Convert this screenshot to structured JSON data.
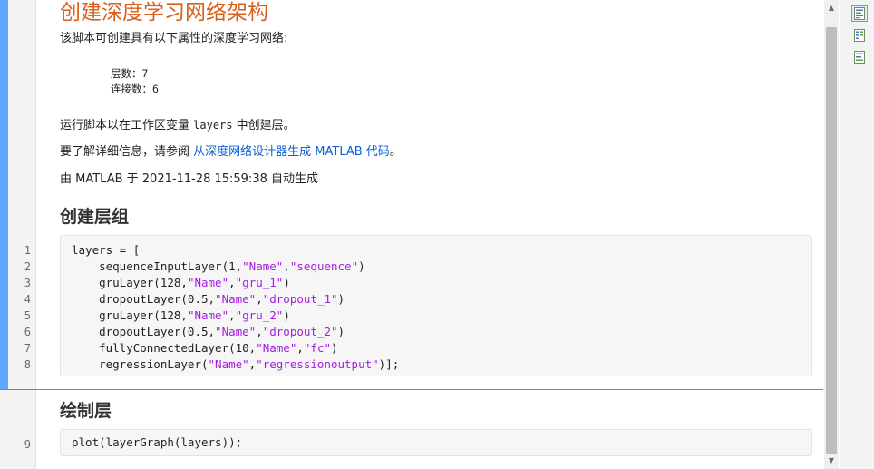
{
  "gutter": {
    "line_numbers": [
      "1",
      "2",
      "3",
      "4",
      "5",
      "6",
      "7",
      "8",
      "9"
    ]
  },
  "doc": {
    "title": "创建深度学习网络架构",
    "intro": "该脚本可创建具有以下属性的深度学习网络:",
    "props": {
      "layers": "层数：7",
      "connections": "连接数：6"
    },
    "run_prefix": "运行脚本以在工作区变量 ",
    "run_var": "layers",
    "run_suffix": " 中创建层。",
    "more_prefix": "要了解详细信息，请参阅 ",
    "more_link": "从深度网络设计器生成 MATLAB 代码",
    "more_suffix": "。",
    "generated": "由 MATLAB 于 2021-11-28 15:59:38 自动生成",
    "section1": "创建层组",
    "section2": "绘制层"
  },
  "code1": [
    {
      "pre": "layers = [",
      "s1": "",
      "m1": "",
      "s2": "",
      "post": ""
    },
    {
      "pre": "    sequenceInputLayer(1,",
      "s1": "\"Name\"",
      "m1": ",",
      "s2": "\"sequence\"",
      "post": ")"
    },
    {
      "pre": "    gruLayer(128,",
      "s1": "\"Name\"",
      "m1": ",",
      "s2": "\"gru_1\"",
      "post": ")"
    },
    {
      "pre": "    dropoutLayer(0.5,",
      "s1": "\"Name\"",
      "m1": ",",
      "s2": "\"dropout_1\"",
      "post": ")"
    },
    {
      "pre": "    gruLayer(128,",
      "s1": "\"Name\"",
      "m1": ",",
      "s2": "\"gru_2\"",
      "post": ")"
    },
    {
      "pre": "    dropoutLayer(0.5,",
      "s1": "\"Name\"",
      "m1": ",",
      "s2": "\"dropout_2\"",
      "post": ")"
    },
    {
      "pre": "    fullyConnectedLayer(10,",
      "s1": "\"Name\"",
      "m1": ",",
      "s2": "\"fc\"",
      "post": ")"
    },
    {
      "pre": "    regressionLayer(",
      "s1": "\"Name\"",
      "m1": ",",
      "s2": "\"regressionoutput\"",
      "post": ")];"
    }
  ],
  "code2": "plot(layerGraph(layers));",
  "scrollbar": {
    "up_icon": "triangle-up",
    "down_icon": "triangle-down"
  },
  "right_panel": {
    "icons": [
      "output-inline-icon",
      "output-right-icon",
      "code-only-icon"
    ]
  },
  "colors": {
    "title": "#d9601a",
    "link": "#0b5ed7",
    "string": "#a61de0",
    "active_bar": "#62a7ff",
    "cell_sep": "#27a7c4"
  }
}
